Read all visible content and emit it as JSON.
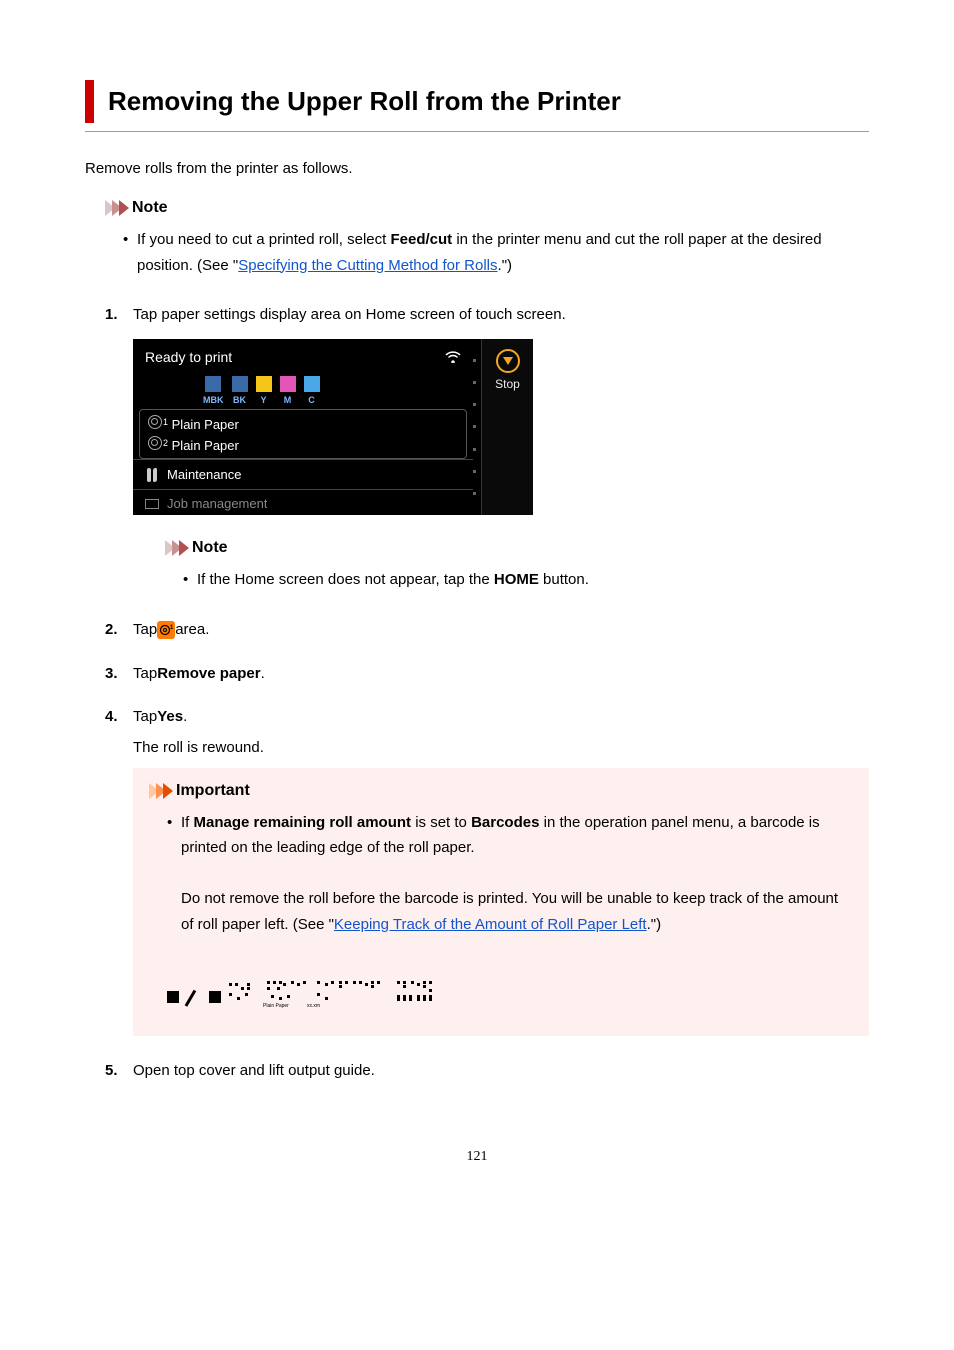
{
  "title": "Removing the Upper Roll from the Printer",
  "intro": "Remove rolls from the printer as follows.",
  "note1": {
    "heading": "Note",
    "bullet_pre": "If you need to cut a printed roll, select ",
    "bullet_bold": "Feed/cut",
    "bullet_mid": " in the printer menu and cut the roll paper at the desired position. (See \"",
    "bullet_link": "Specifying the Cutting Method for Rolls",
    "bullet_post": ".\")"
  },
  "steps": {
    "s1": "Tap paper settings display area on Home screen of touch screen.",
    "s2_pre": "Tap ",
    "s2_post": " area.",
    "s3_pre": "Tap ",
    "s3_bold": "Remove paper",
    "s3_post": ".",
    "s4_pre": "Tap ",
    "s4_bold": "Yes",
    "s4_post": ".",
    "s4_detail": "The roll is rewound.",
    "s5": "Open top cover and lift output guide."
  },
  "screen": {
    "ready": "Ready to print",
    "inks": [
      {
        "label": "MBK",
        "color": "#3a6aa8"
      },
      {
        "label": "BK",
        "color": "#3a6aa8"
      },
      {
        "label": "Y",
        "color": "#f5c518"
      },
      {
        "label": "M",
        "color": "#e455b8"
      },
      {
        "label": "C",
        "color": "#4aa8e8"
      }
    ],
    "paper1": "Plain Paper",
    "paper1_sup": "1",
    "paper2": "Plain Paper",
    "paper2_sup": "2",
    "maintenance": "Maintenance",
    "job": "Job management",
    "stop": "Stop"
  },
  "note2": {
    "heading": "Note",
    "bullet_pre": "If the Home screen does not appear, tap the ",
    "bullet_bold": "HOME",
    "bullet_post": " button."
  },
  "important": {
    "heading": "Important",
    "b1_pre": "If ",
    "b1_bold1": "Manage remaining roll amount",
    "b1_mid1": " is set to ",
    "b1_bold2": "Barcodes",
    "b1_mid2": " in the operation panel menu, a barcode is printed on the leading edge of the roll paper.",
    "b2_pre": "Do not remove the roll before the barcode is printed. You will be unable to keep track of the amount of roll paper left. (See \"",
    "b2_link": "Keeping Track of the Amount of Roll Paper Left",
    "b2_post": ".\")",
    "barcode_sub1": "Plain Paper",
    "barcode_sub2": "xx.xm"
  },
  "page_number": "121"
}
